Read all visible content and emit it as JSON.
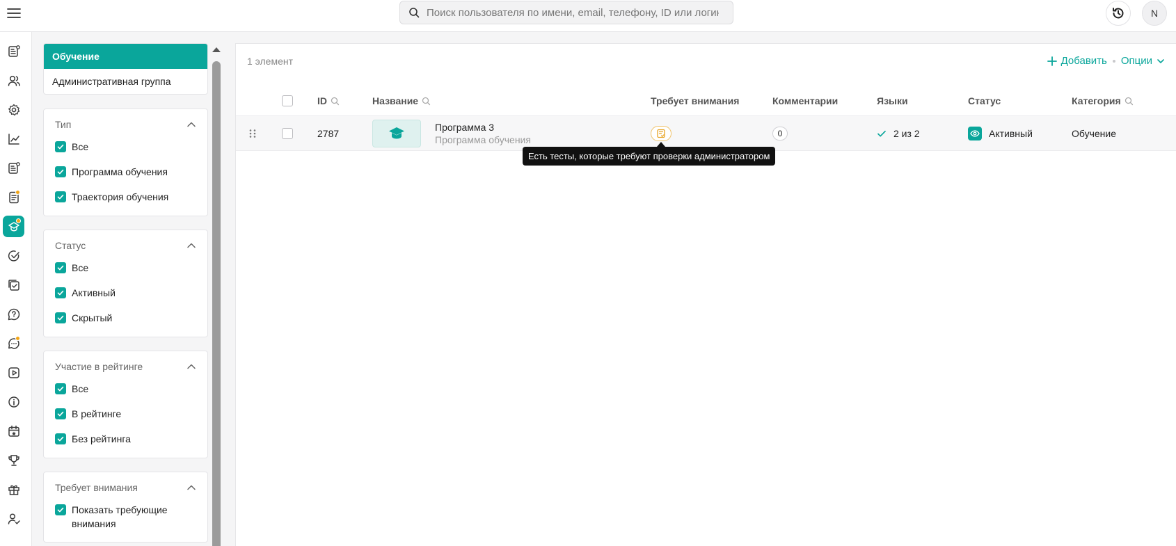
{
  "search": {
    "placeholder": "Поиск пользователя по имени, email, телефону, ID или логину"
  },
  "user": {
    "initial": "N"
  },
  "rail": [
    {
      "icon": "news-icon",
      "active": false,
      "dot": false
    },
    {
      "icon": "users-icon",
      "active": false,
      "dot": false
    },
    {
      "icon": "settings-icon",
      "active": false,
      "dot": false
    },
    {
      "icon": "analytics-icon",
      "active": false,
      "dot": false
    },
    {
      "icon": "articles-icon",
      "active": false,
      "dot": false
    },
    {
      "icon": "documents-icon",
      "active": false,
      "dot": true
    },
    {
      "icon": "learning-icon",
      "active": true,
      "dot": true
    },
    {
      "icon": "tasks-icon",
      "active": false,
      "dot": false
    },
    {
      "icon": "checklists-icon",
      "active": false,
      "dot": false
    },
    {
      "icon": "faq-icon",
      "active": false,
      "dot": false
    },
    {
      "icon": "chat-icon",
      "active": false,
      "dot": true
    },
    {
      "icon": "video-icon",
      "active": false,
      "dot": false
    },
    {
      "icon": "info-icon",
      "active": false,
      "dot": false
    },
    {
      "icon": "calendar-icon",
      "active": false,
      "dot": false
    },
    {
      "icon": "trophy-icon",
      "active": false,
      "dot": false
    },
    {
      "icon": "gift-icon",
      "active": false,
      "dot": false
    },
    {
      "icon": "user-check-icon",
      "active": false,
      "dot": false
    }
  ],
  "categories": [
    {
      "label": "Обучение",
      "active": true
    },
    {
      "label": "Административная группа",
      "active": false
    }
  ],
  "filters": {
    "type": {
      "title": "Тип",
      "options": [
        "Все",
        "Программа обучения",
        "Траектория обучения"
      ]
    },
    "status": {
      "title": "Статус",
      "options": [
        "Все",
        "Активный",
        "Скрытый"
      ]
    },
    "rating": {
      "title": "Участие в рейтинге",
      "options": [
        "Все",
        "В рейтинге",
        "Без рейтинга"
      ]
    },
    "attention": {
      "title": "Требует внимания",
      "options": [
        "Показать требующие внимания"
      ]
    }
  },
  "list": {
    "count": "1 элемент",
    "add_label": "Добавить",
    "options_label": "Опции",
    "columns": {
      "id": "ID",
      "name": "Название",
      "attention": "Требует внимания",
      "comments": "Комментарии",
      "languages": "Языки",
      "status": "Статус",
      "category": "Категория"
    },
    "rows": [
      {
        "id": "2787",
        "title": "Программа 3",
        "subtitle": "Программа обучения",
        "comments": "0",
        "languages": "2 из 2",
        "status": "Активный",
        "category": "Обучение"
      }
    ],
    "tooltip": "Есть тесты, которые требуют проверки администратором"
  },
  "colors": {
    "accent": "#0aa69b",
    "warning": "#f2a516"
  }
}
